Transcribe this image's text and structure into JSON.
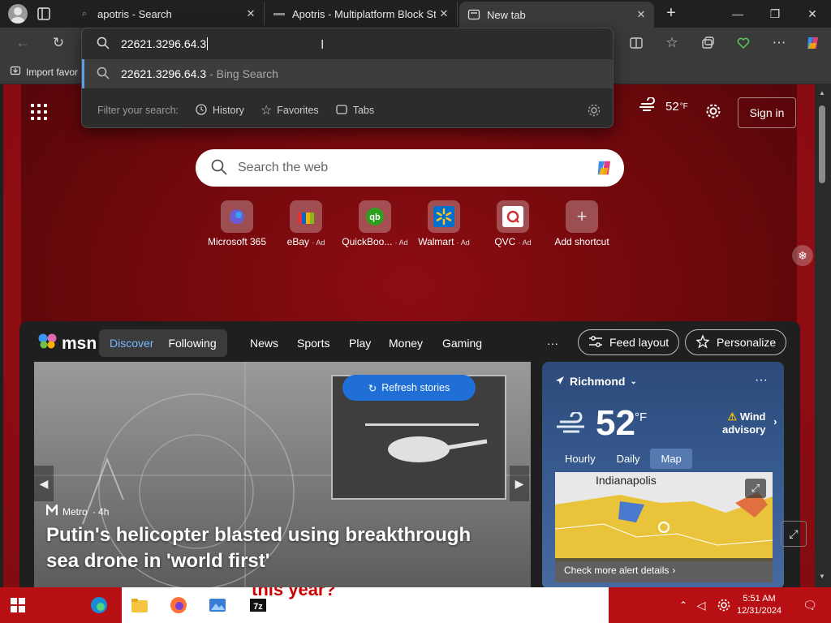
{
  "tabs": [
    {
      "title": "apotris - Search"
    },
    {
      "title": "Apotris - Multiplatform Block Stac"
    },
    {
      "title": "New tab"
    }
  ],
  "favorites_bar": {
    "import_label": "Import favor"
  },
  "omnibox": {
    "value": "22621.3296.64.3",
    "suggestion_query": "22621.3296.64.3",
    "suggestion_source": "- Bing Search",
    "filter_label": "Filter your search:",
    "filters": [
      "History",
      "Favorites",
      "Tabs"
    ]
  },
  "new_tab": {
    "temperature": "52",
    "temp_unit": "°F",
    "sign_in_label": "Sign in",
    "search_placeholder": "Search the web",
    "shortcuts": [
      {
        "label": "Microsoft 365",
        "ad": ""
      },
      {
        "label": "eBay",
        "ad": "· Ad"
      },
      {
        "label": "QuickBoo...",
        "ad": "· Ad"
      },
      {
        "label": "Walmart",
        "ad": "· Ad"
      },
      {
        "label": "QVC",
        "ad": "· Ad"
      },
      {
        "label": "Add shortcut",
        "ad": ""
      }
    ]
  },
  "feed": {
    "logo": "msn",
    "segments": [
      "Discover",
      "Following"
    ],
    "nav": [
      "News",
      "Sports",
      "Play",
      "Money",
      "Gaming"
    ],
    "more": "···",
    "feed_layout_label": "Feed layout",
    "personalize_label": "Personalize",
    "refresh_label": "Refresh stories",
    "source_name": "Metro",
    "source_age": "· 4h",
    "headline": "Putin's helicopter blasted using breakthrough sea drone in 'world first'"
  },
  "weather": {
    "location": "Richmond",
    "temp": "52",
    "unit": "°F",
    "advisory_line1": "Wind",
    "advisory_line2": "advisory",
    "tabs": [
      "Hourly",
      "Daily",
      "Map"
    ],
    "map_city": "Indianapolis",
    "alert_link": "Check more alert details"
  },
  "taskbar": {
    "wallpaper_text": "this year?",
    "time": "5:51 AM",
    "date": "12/31/2024"
  }
}
